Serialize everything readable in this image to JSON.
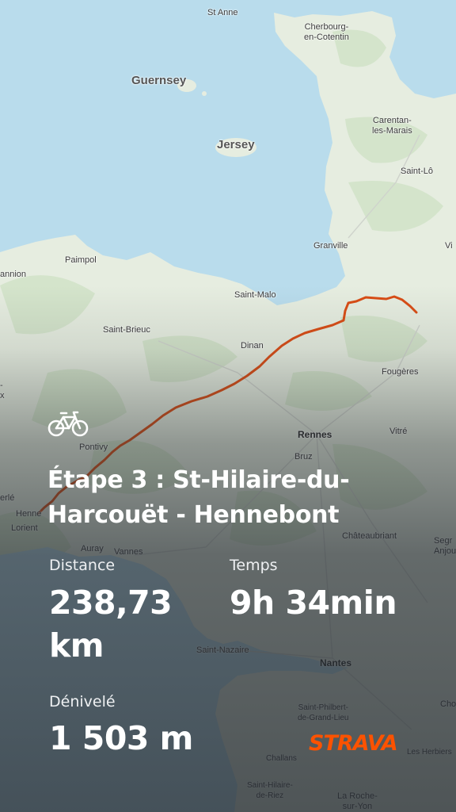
{
  "colors": {
    "sea": "#b9dcec",
    "land": "#e7ede1",
    "route": "#d94d16",
    "strava": "#fc5200"
  },
  "map": {
    "places": [
      {
        "key": "st_anne",
        "text": "St Anne"
      },
      {
        "key": "cherbourg",
        "text": "Cherbourg-\nen-Cotentin"
      },
      {
        "key": "guernsey",
        "text": "Guernsey"
      },
      {
        "key": "jersey",
        "text": "Jersey"
      },
      {
        "key": "carentan",
        "text": "Carentan-\nles-Marais"
      },
      {
        "key": "saint_lo",
        "text": "Saint-Lô"
      },
      {
        "key": "granville",
        "text": "Granville"
      },
      {
        "key": "vi",
        "text": "Vi"
      },
      {
        "key": "paimpol",
        "text": "Paimpol"
      },
      {
        "key": "annion",
        "text": "annion"
      },
      {
        "key": "saint_malo",
        "text": "Saint-Malo"
      },
      {
        "key": "saint_brieuc",
        "text": "Saint-Brieuc"
      },
      {
        "key": "dinan",
        "text": "Dinan"
      },
      {
        "key": "fougeres",
        "text": "Fougères"
      },
      {
        "key": "pontivy",
        "text": "Pontivy"
      },
      {
        "key": "rennes",
        "text": "Rennes"
      },
      {
        "key": "vitre",
        "text": "Vitré"
      },
      {
        "key": "bruz",
        "text": "Bruz"
      },
      {
        "key": "erle",
        "text": "erlé"
      },
      {
        "key": "hennebont_cut",
        "text": "Henne"
      },
      {
        "key": "lorient",
        "text": "Lorient"
      },
      {
        "key": "chateaubriant",
        "text": "Châteaubriant"
      },
      {
        "key": "segre",
        "text": "Segr\nAnjou"
      },
      {
        "key": "auray",
        "text": "Auray"
      },
      {
        "key": "vannes",
        "text": "Vannes"
      },
      {
        "key": "saint_nazaire",
        "text": "Saint-Nazaire"
      },
      {
        "key": "nantes",
        "text": "Nantes"
      },
      {
        "key": "cho",
        "text": "Cho"
      },
      {
        "key": "saint_philbert",
        "text": "Saint-Philbert-\nde-Grand-Lieu"
      },
      {
        "key": "les_herbiers",
        "text": "Les Herbiers"
      },
      {
        "key": "challans",
        "text": "Challans"
      },
      {
        "key": "saint_hilaire_riez",
        "text": "Saint-Hilaire-\nde-Riez"
      },
      {
        "key": "la_roche",
        "text": "La Roche-\nsur-Yon"
      },
      {
        "key": "side_x",
        "text": "-\nx"
      }
    ]
  },
  "activity": {
    "type_icon": "bicycle-icon",
    "title": "Étape 3 : St-Hilaire-du-Harcouët - Hennebont",
    "distance_label": "Distance",
    "distance_value": "238,73 km",
    "time_label": "Temps",
    "time_value": "9h 34min",
    "elevation_label": "Dénivelé",
    "elevation_value": "1 503 m"
  },
  "branding": {
    "logo_text": "STRAVA"
  }
}
